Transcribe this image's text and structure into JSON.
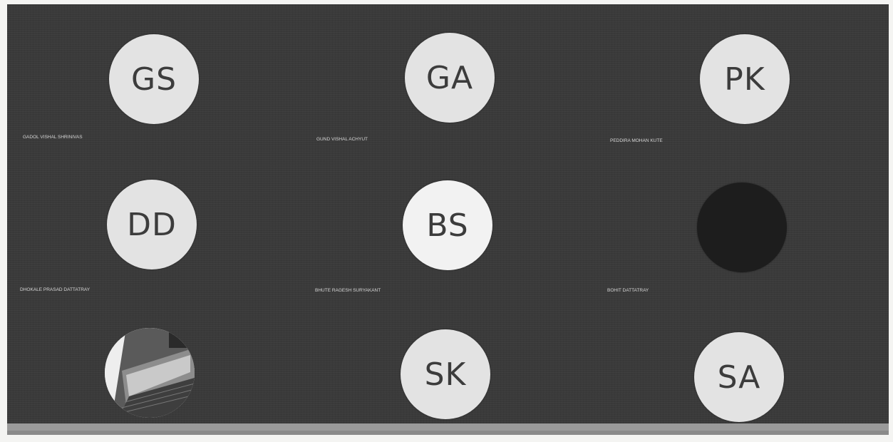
{
  "participants": [
    {
      "initials": "GS",
      "name": "GADOL VISHAL SHRINIVAS"
    },
    {
      "initials": "GA",
      "name": "GUND VISHAL ACHYUT"
    },
    {
      "initials": "PK",
      "name": "PEDDIRA MOHAN KUTE"
    },
    {
      "initials": "DD",
      "name": "DHOKALE PRASAD DATTATRAY"
    },
    {
      "initials": "BS",
      "name": "BHUTE RAGESH SURYAKANT"
    },
    {
      "initials": "",
      "name": "BOHIT DATTATRAY"
    },
    {
      "initials": "",
      "name": ""
    },
    {
      "initials": "SK",
      "name": ""
    },
    {
      "initials": "SA",
      "name": ""
    }
  ]
}
